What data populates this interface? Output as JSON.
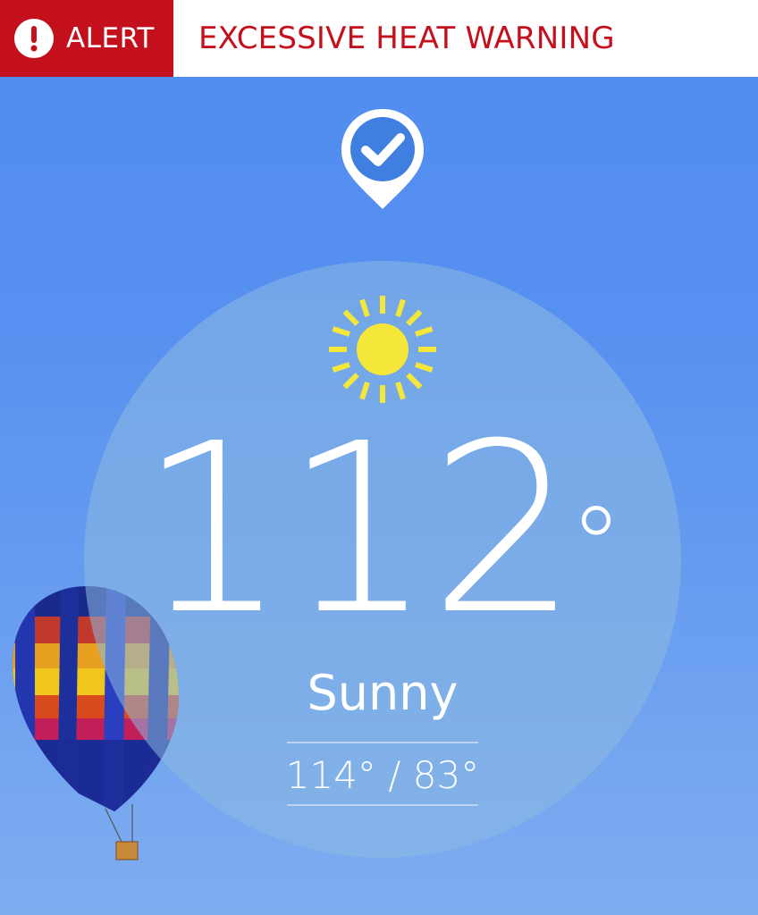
{
  "alert": {
    "badge_label": "ALERT",
    "title": "EXCESSIVE HEAT WARNING",
    "icon": "exclamation-circle-icon",
    "color": "#c4101c"
  },
  "location": {
    "icon": "location-pin-check-icon"
  },
  "weather": {
    "icon": "sun-icon",
    "temperature": "112",
    "degree_symbol": "°",
    "condition": "Sunny",
    "high_low": "114° / 83°"
  },
  "background": {
    "image": "hot-air-balloon-sky"
  },
  "colors": {
    "sky": "#5690f0",
    "alert_red": "#c4101c",
    "sun": "#f5e63a"
  }
}
